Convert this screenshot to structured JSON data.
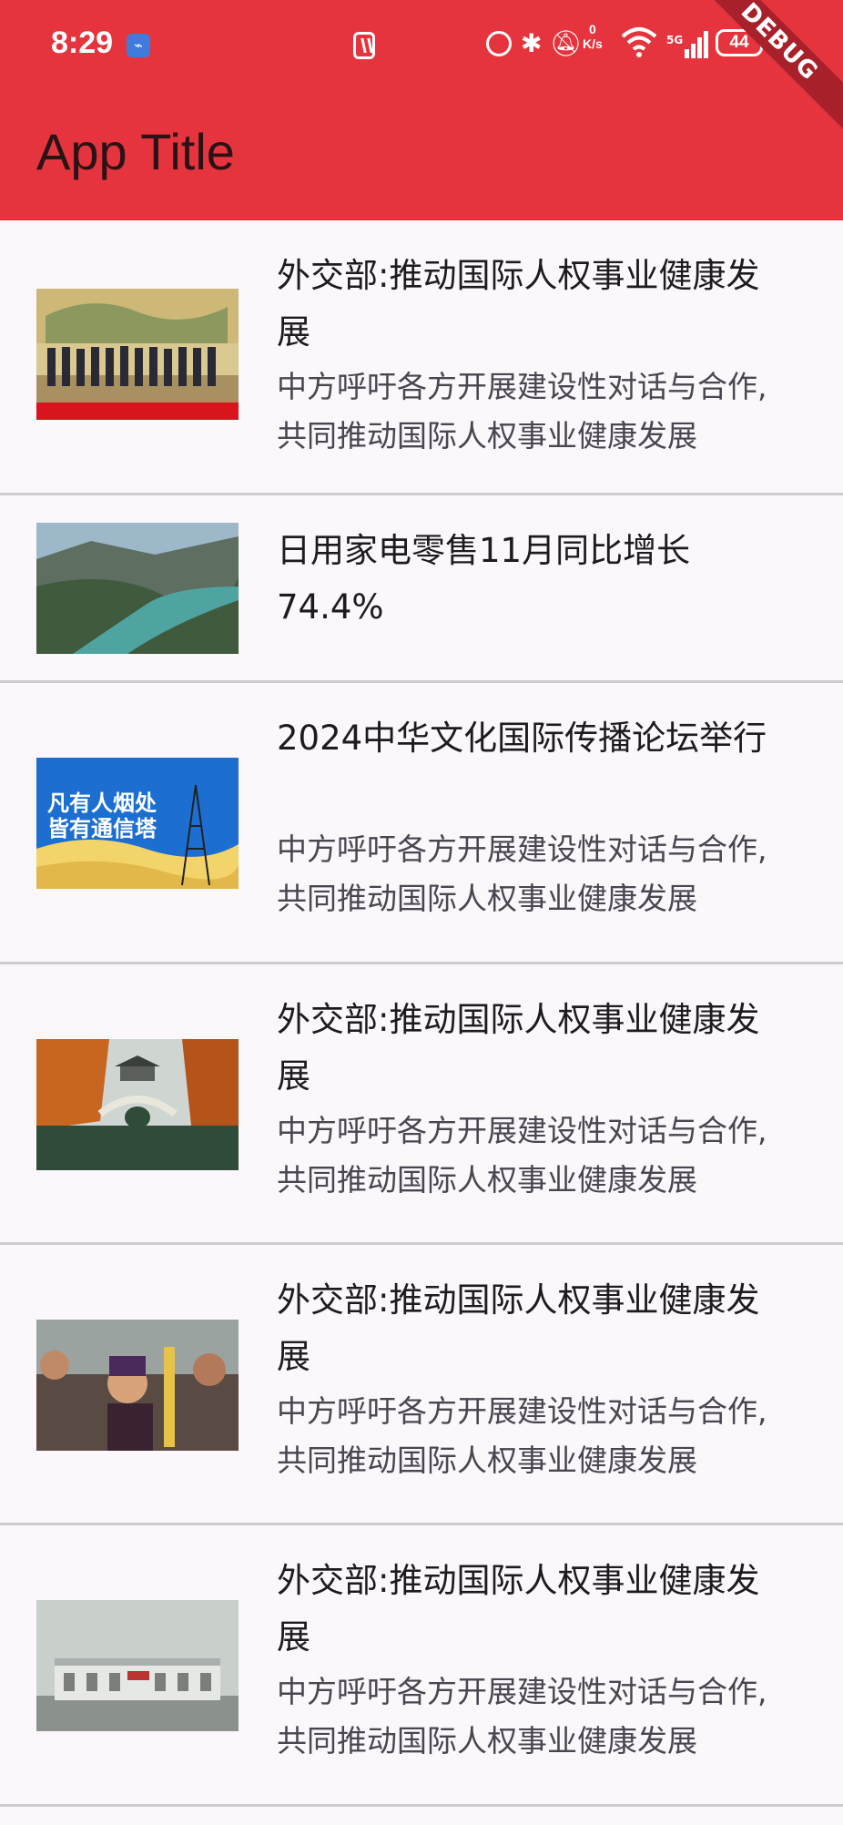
{
  "status_bar": {
    "time": "8:29",
    "speed_value": "0",
    "speed_unit": "K/s",
    "network": "5G",
    "battery": "44",
    "icons": [
      "usb-icon",
      "nfc-icon",
      "alarm-icon",
      "bluetooth-icon",
      "mute-icon",
      "wifi-icon",
      "signal-icon",
      "battery-icon"
    ]
  },
  "debug_banner": "DEBUG",
  "app_bar": {
    "title": "App Title"
  },
  "news": [
    {
      "title": "外交部:推动国际人权事业健康发展",
      "subtitle": "中方呼吁各方开展建设性对话与合作,共同推动国际人权事业健康发展",
      "image": "diplomatic-group-photo"
    },
    {
      "title": "日用家电零售11月同比增长74.4%",
      "subtitle": "",
      "image": "river-valley-photo"
    },
    {
      "title": "2024中华文化国际传播论坛举行",
      "subtitle": "中方呼吁各方开展建设性对话与合作,共同推动国际人权事业健康发展",
      "image": "signal-tower-poster",
      "image_text": "凡有人烟处 皆有通信塔"
    },
    {
      "title": "外交部:推动国际人权事业健康发展",
      "subtitle": "中方呼吁各方开展建设性对话与合作,共同推动国际人权事业健康发展",
      "image": "autumn-bridge-photo"
    },
    {
      "title": "外交部:推动国际人权事业健康发展",
      "subtitle": "中方呼吁各方开展建设性对话与合作,共同推动国际人权事业健康发展",
      "image": "festival-children-photo"
    },
    {
      "title": "外交部:推动国际人权事业健康发展",
      "subtitle": "中方呼吁各方开展建设性对话与合作,共同推动国际人权事业健康发展",
      "image": "railway-station-photo"
    }
  ],
  "colors": {
    "app_bar": "#e5343d",
    "background": "#fbf7fb",
    "divider": "#cfcbd0"
  }
}
